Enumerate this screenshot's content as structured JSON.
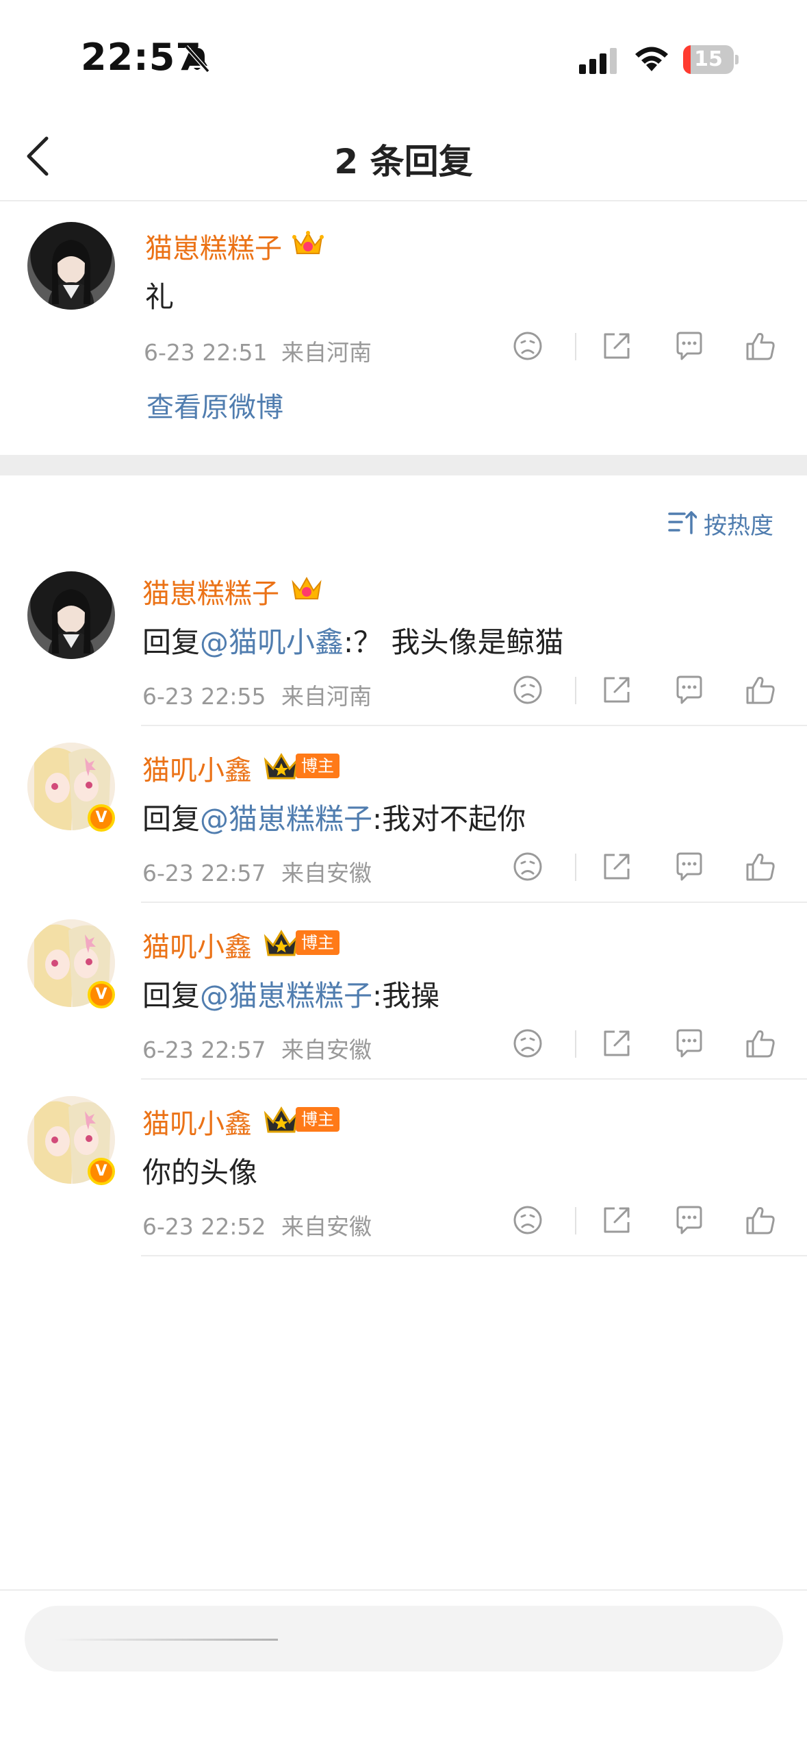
{
  "status_bar": {
    "time": "22:57",
    "battery": "15",
    "battery_level": 0.15,
    "battery_color": "#ff3b30"
  },
  "nav": {
    "title": "2 条回复"
  },
  "original_comment": {
    "username": "猫崽糕糕子",
    "text": "礼",
    "time": "6-23 22:51",
    "location": "来自河南",
    "view_original_label": "查看原微博"
  },
  "sort_label": "按热度",
  "replies": [
    {
      "username": "猫崽糕糕子",
      "prefix": "回复",
      "mention": "@猫叽小鑫",
      "body": ":？ 我头像是鲸猫",
      "time": "6-23 22:55",
      "location": "来自河南"
    },
    {
      "username": "猫叽小鑫",
      "badge": "博主",
      "prefix": "回复",
      "mention": "@猫崽糕糕子",
      "body": ":我对不起你",
      "time": "6-23 22:57",
      "location": "来自安徽"
    },
    {
      "username": "猫叽小鑫",
      "badge": "博主",
      "prefix": "回复",
      "mention": "@猫崽糕糕子",
      "body": ":我操",
      "time": "6-23 22:57",
      "location": "来自安徽"
    },
    {
      "username": "猫叽小鑫",
      "badge": "博主",
      "body": "你的头像",
      "time": "6-23 22:52",
      "location": "来自安徽"
    }
  ],
  "avatar_badge": "V",
  "colors": {
    "username": "#eb7216",
    "mention": "#507daf",
    "meta": "#999999",
    "badge": "#ff7a18"
  },
  "icons": [
    "back-icon",
    "mute-bell-icon",
    "signal-icon",
    "wifi-icon",
    "battery-icon",
    "dislike-icon",
    "share-icon",
    "comment-icon",
    "like-icon",
    "crown-icon",
    "sort-icon",
    "verified-v-icon"
  ]
}
